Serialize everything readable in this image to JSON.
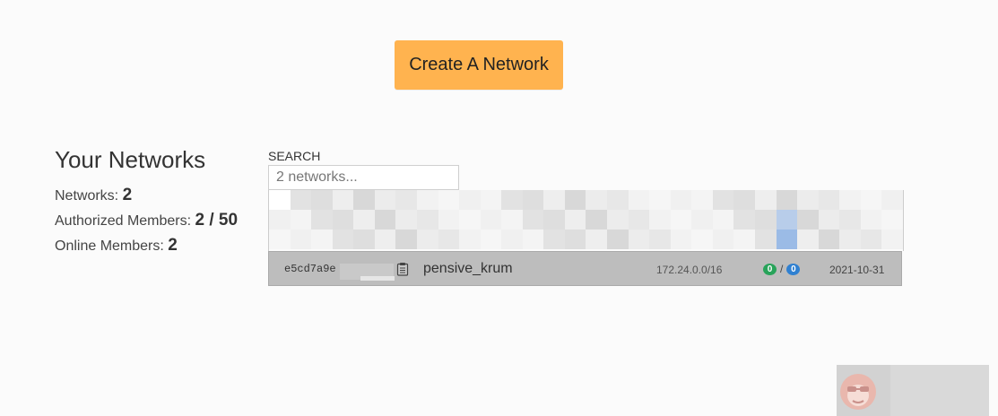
{
  "header": {
    "create_button_label": "Create A Network"
  },
  "sidebar": {
    "title": "Your Networks",
    "stats": [
      {
        "label": "Networks:",
        "value": "2"
      },
      {
        "label": "Authorized Members:",
        "value": "2 / 50"
      },
      {
        "label": "Online Members:",
        "value": "2"
      }
    ]
  },
  "search": {
    "label": "SEARCH",
    "placeholder": "2 networks..."
  },
  "networks": [
    {
      "id": "e5cd7a9e",
      "name": "pensive_krum",
      "subnet": "172.24.0.0/16",
      "online": "0",
      "authorized": "0",
      "created": "2021-10-31",
      "badge_colors": {
        "online": "#28a35a",
        "authorized": "#2f80d1"
      }
    }
  ],
  "icons": {
    "copy": "clipboard-icon"
  },
  "colors": {
    "accent": "#ffb34f",
    "row_bg": "#bdbdbd"
  }
}
